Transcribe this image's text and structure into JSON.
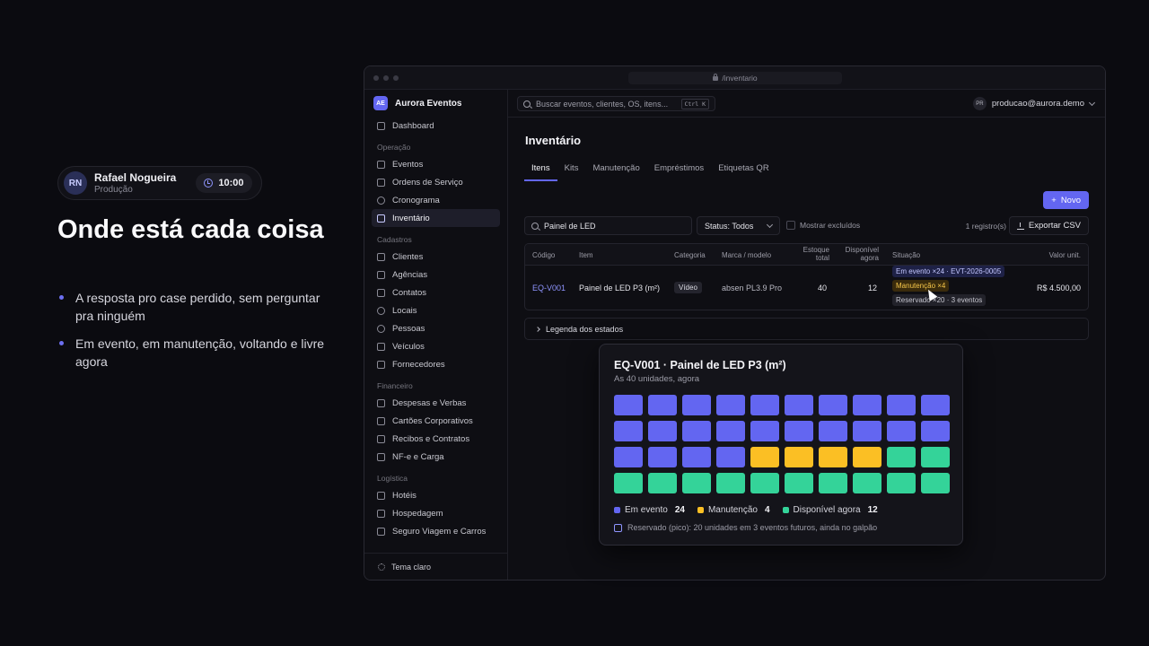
{
  "presenter": {
    "initials": "RN",
    "name": "Rafael Nogueira",
    "role": "Produção",
    "timer": "10:00"
  },
  "slide": {
    "headline": "Onde está cada coisa",
    "bullets": [
      "A resposta pro case perdido, sem perguntar pra ninguém",
      "Em evento, em manutenção, voltando e livre agora"
    ]
  },
  "browser": {
    "url": "/inventario"
  },
  "app": {
    "brand_initials": "AE",
    "brand_name": "Aurora Eventos",
    "sidebar": {
      "top": [
        {
          "label": "Dashboard",
          "icon": "grid-icon"
        }
      ],
      "groups": [
        {
          "label": "Operação",
          "items": [
            {
              "label": "Eventos",
              "icon": "calendar-icon"
            },
            {
              "label": "Ordens de Serviço",
              "icon": "clipboard-icon"
            },
            {
              "label": "Cronograma",
              "icon": "clock-icon"
            },
            {
              "label": "Inventário",
              "icon": "box-icon",
              "active": true
            }
          ]
        },
        {
          "label": "Cadastros",
          "items": [
            {
              "label": "Clientes",
              "icon": "building-icon"
            },
            {
              "label": "Agências",
              "icon": "users-icon"
            },
            {
              "label": "Contatos",
              "icon": "contact-icon"
            },
            {
              "label": "Locais",
              "icon": "map-pin-icon"
            },
            {
              "label": "Pessoas",
              "icon": "user-icon"
            },
            {
              "label": "Veículos",
              "icon": "truck-icon"
            },
            {
              "label": "Fornecedores",
              "icon": "store-icon"
            }
          ]
        },
        {
          "label": "Financeiro",
          "items": [
            {
              "label": "Despesas e Verbas",
              "icon": "wallet-icon"
            },
            {
              "label": "Cartões Corporativos",
              "icon": "credit-card-icon"
            },
            {
              "label": "Recibos e Contratos",
              "icon": "receipt-icon"
            },
            {
              "label": "NF-e e Carga",
              "icon": "file-icon"
            }
          ]
        },
        {
          "label": "Logística",
          "items": [
            {
              "label": "Hotéis",
              "icon": "hotel-icon"
            },
            {
              "label": "Hospedagem",
              "icon": "bed-icon"
            },
            {
              "label": "Seguro Viagem e Carros",
              "icon": "plane-icon"
            }
          ]
        }
      ],
      "theme_toggle": "Tema claro"
    },
    "topbar": {
      "search_placeholder": "Buscar eventos, clientes, OS, itens...",
      "shortcut": "Ctrl K",
      "user_initials": "PR",
      "user_email": "producao@aurora.demo"
    },
    "page": {
      "title": "Inventário",
      "tabs": [
        "Itens",
        "Kits",
        "Manutenção",
        "Empréstimos",
        "Etiquetas QR"
      ],
      "active_tab": "Itens",
      "new_button": "Novo",
      "filter_search": "Painel de LED",
      "status_filter": "Status: Todos",
      "show_deleted": "Mostrar excluídos",
      "record_count": "1 registro(s)",
      "export_button": "Exportar CSV",
      "columns": {
        "code": "Código",
        "item": "Item",
        "category": "Categoria",
        "brand": "Marca / modelo",
        "stock": "Estoque total",
        "available": "Disponível agora",
        "status": "Situação",
        "unit_value": "Valor unit."
      },
      "row": {
        "code": "EQ-V001",
        "item": "Painel de LED P3 (m²)",
        "category": "Vídeo",
        "brand": "absen PL3.9 Pro",
        "stock": "40",
        "available": "12",
        "chips": [
          "Em evento ×24 · EVT-2026-0005",
          "Manutenção ×4",
          "Reservado ×20 · 3 eventos"
        ],
        "unit_value": "R$ 4.500,00"
      },
      "legend_toggle": "Legenda dos estados"
    }
  },
  "popover": {
    "title": "EQ-V001 · Painel de LED P3 (m²)",
    "subtitle": "As 40 unidades, agora",
    "units": {
      "in_event": 24,
      "maintenance": 4,
      "available": 12
    },
    "colors": {
      "in_event": "#6366f1",
      "maintenance": "#fbbf24",
      "available": "#34d399"
    },
    "legend": [
      {
        "label": "Em evento",
        "count": "24",
        "color": "#6366f1"
      },
      {
        "label": "Manutenção",
        "count": "4",
        "color": "#fbbf24"
      },
      {
        "label": "Disponível agora",
        "count": "12",
        "color": "#34d399"
      }
    ],
    "reserved_note": "Reservado (pico): 20 unidades em 3 eventos futuros, ainda no galpão"
  },
  "accent_color": "#6366f1"
}
